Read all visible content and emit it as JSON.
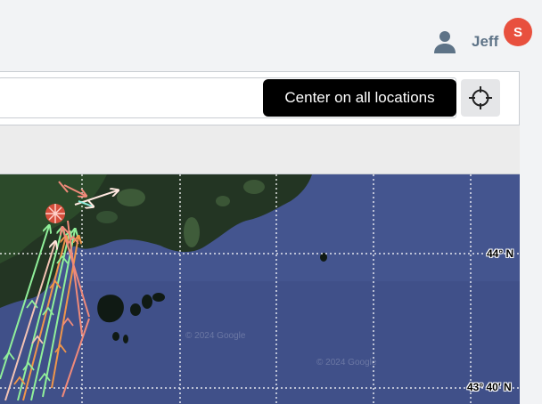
{
  "user": {
    "name": "Jeff",
    "avatar_initial": "S",
    "icon": "user-icon"
  },
  "search": {
    "value": "",
    "placeholder": ""
  },
  "tooltip": {
    "text": "Center on all locations"
  },
  "center_button": {
    "icon": "crosshair-icon"
  },
  "map": {
    "lat_labels": [
      "44° N",
      "43° 40′ N"
    ],
    "watermarks": [
      "© 2024 Google",
      "© 2024 Google"
    ]
  },
  "colors": {
    "accent_badge": "#e8503e",
    "ocean": "#44558f",
    "land": "#233523",
    "track_green": "#90f09a",
    "track_orange": "#f0964a",
    "track_salmon": "#f08a7a",
    "track_white": "#ffe8e0"
  }
}
